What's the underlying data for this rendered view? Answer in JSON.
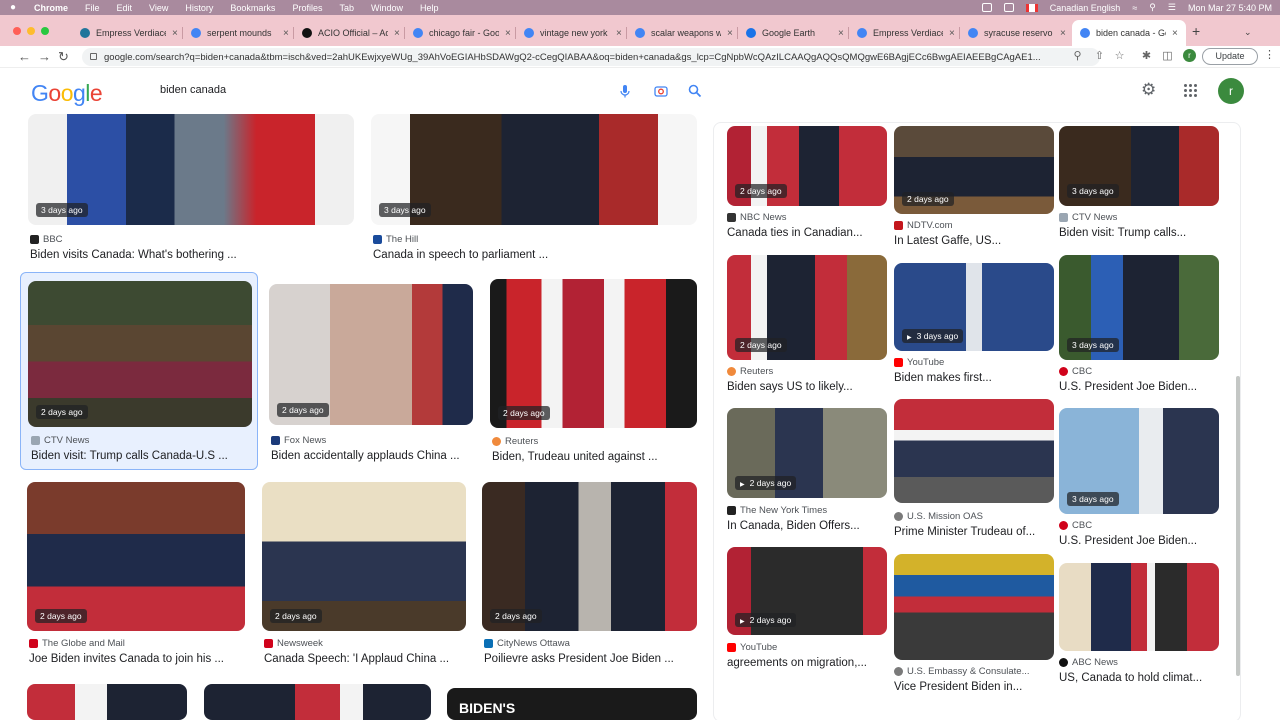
{
  "menubar": {
    "app": "Chrome",
    "items": [
      "File",
      "Edit",
      "View",
      "History",
      "Bookmarks",
      "Profiles",
      "Tab",
      "Window",
      "Help"
    ],
    "input_source": "Canadian English",
    "clock": "Mon Mar 27  5:40 PM"
  },
  "tabs": [
    {
      "title": "Empress Verdiace",
      "color": "#21759b"
    },
    {
      "title": "serpent mounds",
      "color": "#4285f4"
    },
    {
      "title": "ACIO Official – Ad",
      "color": "#111111"
    },
    {
      "title": "chicago fair - Goo",
      "color": "#4285f4"
    },
    {
      "title": "vintage new york",
      "color": "#4285f4"
    },
    {
      "title": "scalar weapons w",
      "color": "#4285f4"
    },
    {
      "title": "Google Earth",
      "color": "#1a73e8"
    },
    {
      "title": "Empress Verdiace",
      "color": "#4285f4"
    },
    {
      "title": "syracuse reservo",
      "color": "#4285f4"
    },
    {
      "title": "biden canada - Go",
      "color": "#4285f4"
    }
  ],
  "toolbar": {
    "url": "google.com/search?q=biden+canada&tbm=isch&ved=2ahUKEwjxyeWUg_39AhVoEGIAHbSDAWgQ2-cCegQIABAA&oq=biden+canada&gs_lcp=CgNpbWcQAzILCAAQgAQQsQMQgwE6BAgjECc6BwgAEIAEEBgCAgAE1...",
    "update_label": "Update",
    "profile_initial": "r"
  },
  "google": {
    "logo": "Google",
    "query": "biden canada",
    "avatar_initial": "r"
  },
  "results_left": [
    {
      "age": "3 days ago",
      "source": "BBC",
      "title": "Biden visits Canada: What's bothering ..."
    },
    {
      "age": "3 days ago",
      "source": "The Hill",
      "title": "Canada in speech to parliament ..."
    },
    {
      "age": "2 days ago",
      "source": "CTV News",
      "title": "Biden visit: Trump calls Canada-U.S ..."
    },
    {
      "age": "2 days ago",
      "source": "Fox News",
      "title": "Biden accidentally applauds China ..."
    },
    {
      "age": "2 days ago",
      "source": "Reuters",
      "title": "Biden, Trudeau united against ..."
    },
    {
      "age": "2 days ago",
      "source": "The Globe and Mail",
      "title": "Joe Biden invites Canada to join his ..."
    },
    {
      "age": "2 days ago",
      "source": "Newsweek",
      "title": "Canada Speech: 'I Applaud China ..."
    },
    {
      "age": "2 days ago",
      "source": "CityNews Ottawa",
      "title": "Poilievre asks President Joe Biden ..."
    }
  ],
  "results_right": [
    {
      "age": "2 days ago",
      "source": "NBC News",
      "title": "Canada ties in Canadian..."
    },
    {
      "age": "2 days ago",
      "source": "NDTV.com",
      "title": "In Latest Gaffe, US..."
    },
    {
      "age": "3 days ago",
      "source": "CTV News",
      "title": "Biden visit: Trump calls..."
    },
    {
      "age": "2 days ago",
      "source": "Reuters",
      "title": "Biden says US to likely..."
    },
    {
      "age": "3 days ago",
      "source": "YouTube",
      "title": "Biden makes first..."
    },
    {
      "age": "3 days ago",
      "source": "CBC",
      "title": "U.S. President Joe Biden..."
    },
    {
      "age": "2 days ago",
      "source": "The New York Times",
      "title": "In Canada, Biden Offers..."
    },
    {
      "age": "",
      "source": "U.S. Mission OAS",
      "title": "Prime Minister Trudeau of..."
    },
    {
      "age": "3 days ago",
      "source": "CBC",
      "title": "U.S. President Joe Biden..."
    },
    {
      "age": "2 days ago",
      "source": "YouTube",
      "title": "agreements on migration,..."
    },
    {
      "age": "",
      "source": "U.S. Embassy & Consulate...",
      "title": "Vice President Biden in..."
    },
    {
      "age": "",
      "source": "ABC News",
      "title": "US, Canada to hold climat..."
    }
  ]
}
